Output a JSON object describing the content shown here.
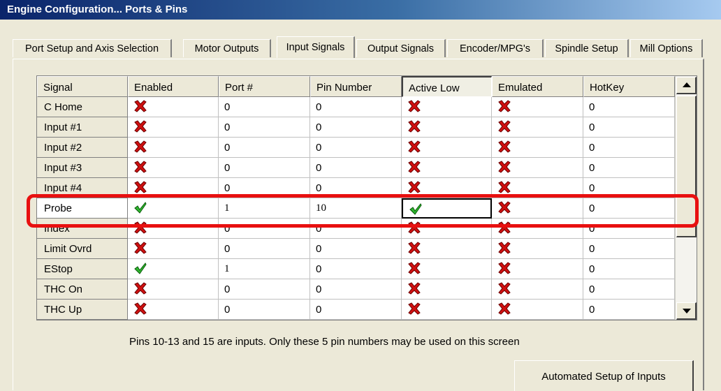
{
  "window": {
    "title": "Engine Configuration... Ports & Pins"
  },
  "tabs": [
    {
      "label": "Port Setup and Axis Selection",
      "active": false
    },
    {
      "label": "Motor Outputs",
      "active": false
    },
    {
      "label": "Input Signals",
      "active": true
    },
    {
      "label": "Output Signals",
      "active": false
    },
    {
      "label": "Encoder/MPG's",
      "active": false
    },
    {
      "label": "Spindle Setup",
      "active": false
    },
    {
      "label": "Mill Options",
      "active": false
    }
  ],
  "grid": {
    "columns": [
      "Signal",
      "Enabled",
      "Port #",
      "Pin Number",
      "Active Low",
      "Emulated",
      "HotKey"
    ],
    "rows": [
      {
        "signal": "C Home",
        "enabled": false,
        "port": "0",
        "pin": "0",
        "active_low": false,
        "emulated": false,
        "hotkey": "0"
      },
      {
        "signal": "Input #1",
        "enabled": false,
        "port": "0",
        "pin": "0",
        "active_low": false,
        "emulated": false,
        "hotkey": "0"
      },
      {
        "signal": "Input #2",
        "enabled": false,
        "port": "0",
        "pin": "0",
        "active_low": false,
        "emulated": false,
        "hotkey": "0"
      },
      {
        "signal": "Input #3",
        "enabled": false,
        "port": "0",
        "pin": "0",
        "active_low": false,
        "emulated": false,
        "hotkey": "0"
      },
      {
        "signal": "Input #4",
        "enabled": false,
        "port": "0",
        "pin": "0",
        "active_low": false,
        "emulated": false,
        "hotkey": "0"
      },
      {
        "signal": "Probe",
        "enabled": true,
        "port": "1",
        "pin": "10",
        "active_low": true,
        "emulated": false,
        "hotkey": "0",
        "selected": true
      },
      {
        "signal": "Index",
        "enabled": false,
        "port": "0",
        "pin": "0",
        "active_low": false,
        "emulated": false,
        "hotkey": "0"
      },
      {
        "signal": "Limit Ovrd",
        "enabled": false,
        "port": "0",
        "pin": "0",
        "active_low": false,
        "emulated": false,
        "hotkey": "0"
      },
      {
        "signal": "EStop",
        "enabled": true,
        "port": "1",
        "pin": "0",
        "active_low": false,
        "emulated": false,
        "hotkey": "0"
      },
      {
        "signal": "THC On",
        "enabled": false,
        "port": "0",
        "pin": "0",
        "active_low": false,
        "emulated": false,
        "hotkey": "0"
      },
      {
        "signal": "THC Up",
        "enabled": false,
        "port": "0",
        "pin": "0",
        "active_low": false,
        "emulated": false,
        "hotkey": "0"
      }
    ]
  },
  "info_text": "Pins 10-13 and 15 are inputs. Only these 5 pin numbers may be used on this screen",
  "buttons": {
    "automated_setup": "Automated Setup of Inputs"
  },
  "icons": {
    "enabled_true": "green-check-icon",
    "enabled_false": "red-x-icon",
    "scroll_up": "scroll-up-arrow-icon",
    "scroll_down": "scroll-down-arrow-icon"
  },
  "colors": {
    "highlight": "#e81010",
    "title_bar": "#0a246a",
    "check_green": "#2fb62f",
    "cross_red": "#d01010"
  }
}
